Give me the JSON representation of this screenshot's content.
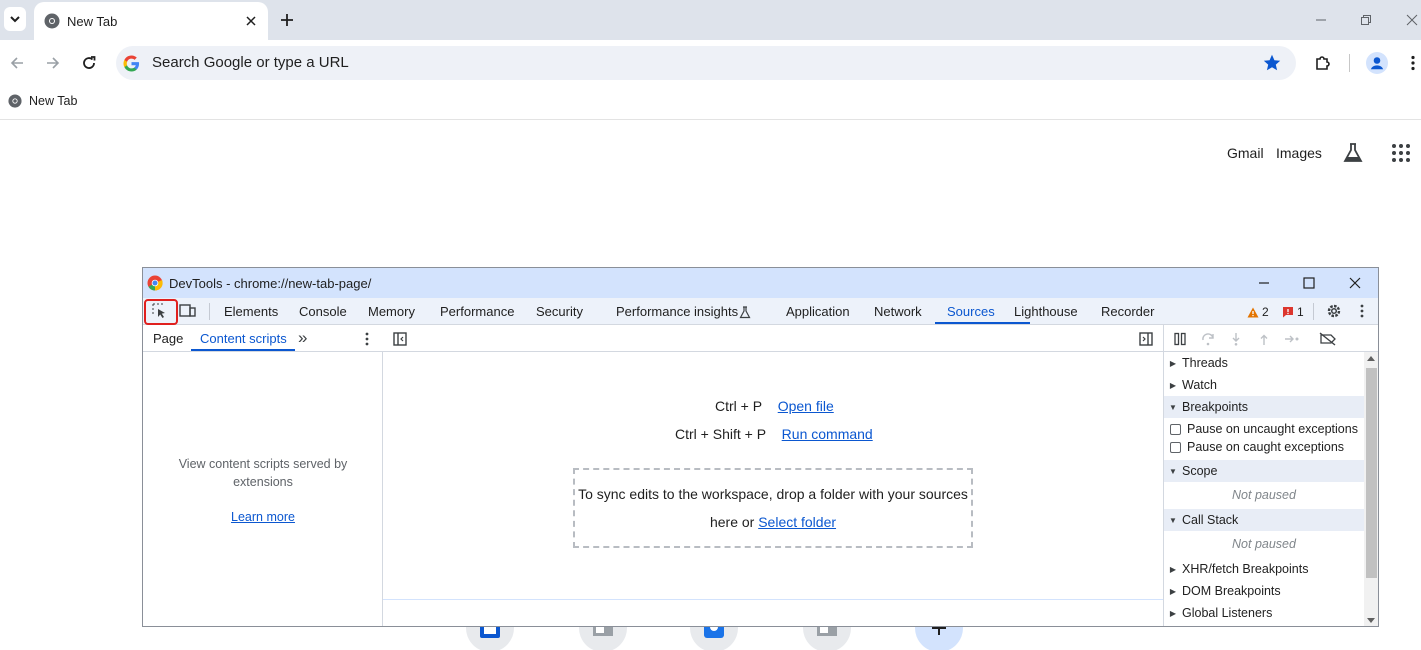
{
  "browser": {
    "tab": {
      "title": "New Tab"
    },
    "omnibox": {
      "placeholder": "Search Google or type a URL"
    },
    "bookmarks": [
      {
        "label": "New Tab"
      }
    ]
  },
  "page": {
    "header_links": [
      "Gmail",
      "Images"
    ]
  },
  "devtools": {
    "title": "DevTools - chrome://new-tab-page/",
    "tabs": [
      "Elements",
      "Console",
      "Memory",
      "Performance",
      "Security",
      "Performance insights",
      "Application",
      "Network",
      "Sources",
      "Lighthouse",
      "Recorder"
    ],
    "active_tab": "Sources",
    "warnings_count": "2",
    "errors_count": "1",
    "navigator": {
      "tabs": [
        "Page",
        "Content scripts"
      ],
      "more": "»",
      "empty_text": "View content scripts served by extensions",
      "learn_more": "Learn more"
    },
    "editor": {
      "open_file_shortcut": "Ctrl + P",
      "open_file_label": "Open file",
      "run_command_shortcut": "Ctrl + Shift + P",
      "run_command_label": "Run command",
      "dropzone_text": "To sync edits to the workspace, drop a folder with your sources here or",
      "select_folder": "Select folder"
    },
    "debugger": {
      "sections": {
        "threads": "Threads",
        "watch": "Watch",
        "breakpoints": "Breakpoints",
        "pause_uncaught": "Pause on uncaught exceptions",
        "pause_caught": "Pause on caught exceptions",
        "scope": "Scope",
        "scope_status": "Not paused",
        "call_stack": "Call Stack",
        "call_stack_status": "Not paused",
        "xhr": "XHR/fetch Breakpoints",
        "dom": "DOM Breakpoints",
        "global": "Global Listeners"
      }
    }
  },
  "colors": {
    "accent": "#0b57d0",
    "tabstrip": "#dee3eb",
    "devtools_titlebar": "#d3e3fd",
    "highlight": "#e0201e"
  }
}
